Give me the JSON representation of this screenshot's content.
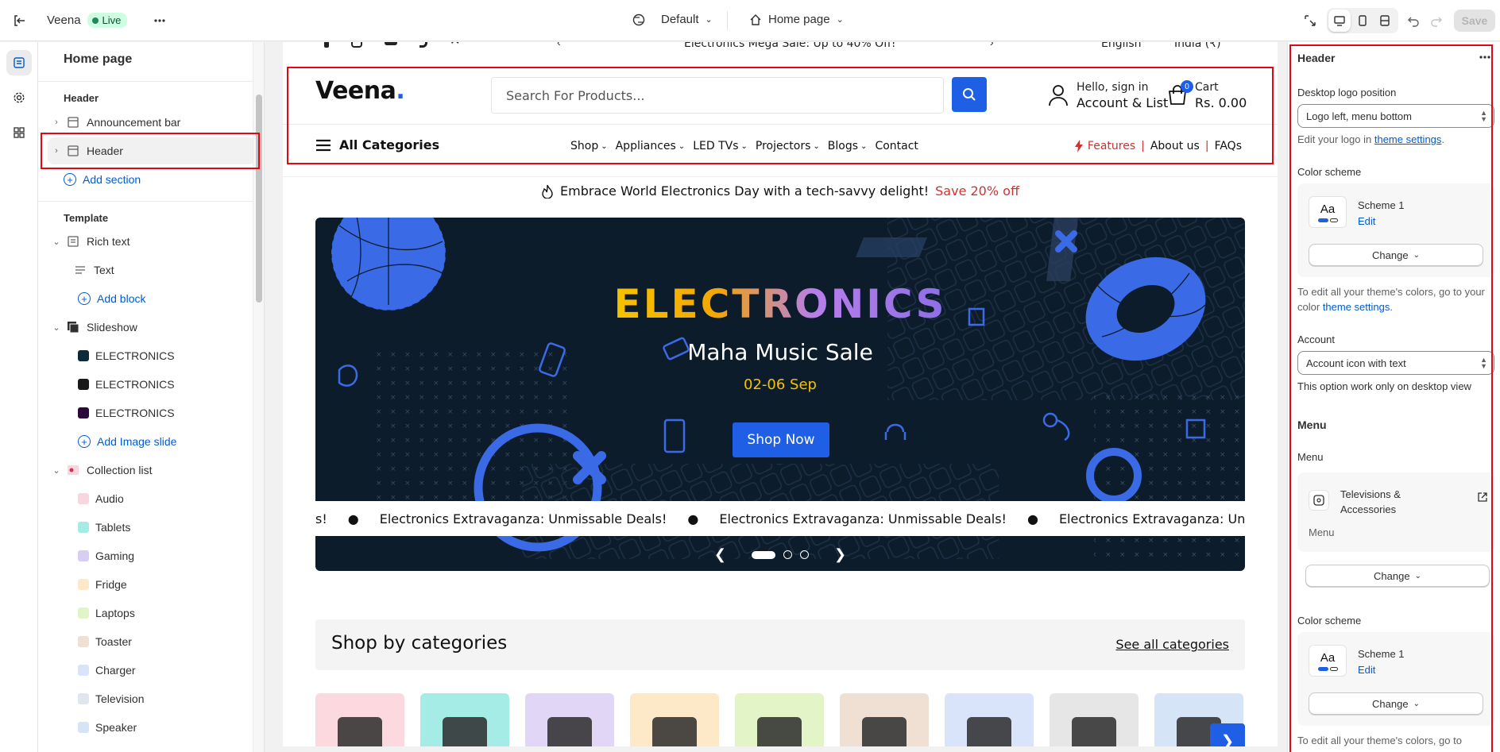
{
  "topbar": {
    "store_name": "Veena",
    "live_label": "Live",
    "theme_label": "Default",
    "page_label": "Home page",
    "save_label": "Save"
  },
  "left_panel": {
    "title": "Home page",
    "header_group": "Header",
    "sections": [
      {
        "label": "Announcement bar"
      },
      {
        "label": "Header"
      }
    ],
    "add_section_label": "Add section",
    "template_group": "Template",
    "template_items": [
      {
        "label": "Rich text"
      },
      {
        "label": "Text"
      },
      {
        "label": "Add block"
      },
      {
        "label": "Slideshow"
      },
      {
        "label": "ELECTRONICS",
        "color": "#0c2a3a"
      },
      {
        "label": "ELECTRONICS",
        "color": "#1a1a1a"
      },
      {
        "label": "ELECTRONICS",
        "color": "#2a0a3a"
      },
      {
        "label": "Add Image slide"
      },
      {
        "label": "Collection list"
      },
      {
        "label": "Audio"
      },
      {
        "label": "Tablets"
      },
      {
        "label": "Gaming"
      },
      {
        "label": "Fridge"
      },
      {
        "label": "Laptops"
      },
      {
        "label": "Toaster"
      },
      {
        "label": "Charger"
      },
      {
        "label": "Television"
      },
      {
        "label": "Speaker"
      }
    ]
  },
  "preview": {
    "announcement_partial": "Electronics Mega Sale: Up to 40% Off!",
    "language": "English",
    "country": "India (₹)",
    "logo_text": "Veena",
    "logo_dot": ".",
    "search_placeholder": "Search For Products...",
    "account_small": "Hello, sign in",
    "account_big": "Account & List",
    "cart_count": "0",
    "cart_small": "Cart",
    "cart_big": "Rs. 0.00",
    "all_categories": "All Categories",
    "menu_items": [
      "Shop",
      "Appliances",
      "LED TVs",
      "Projectors",
      "Blogs",
      "Contact"
    ],
    "menu_has_caret": [
      true,
      true,
      true,
      true,
      true,
      false
    ],
    "features_label": "Features",
    "about_label": "About us",
    "faqs_label": "FAQs",
    "promo_text": "Embrace World Electronics Day with a tech-savvy delight!",
    "promo_highlight": "Save 20% off",
    "banner_title": "ELECTRONICS",
    "banner_subtitle": "Maha Music Sale",
    "banner_date": "02-06 Sep",
    "banner_button": "Shop Now",
    "marquee_items": [
      "s!",
      "Electronics Extravaganza: Unmissable Deals!",
      "Electronics Extravaganza: Unmissable Deals!",
      "Electronics Extravaganza: Unmissable Deals!"
    ],
    "shop_categories_title": "Shop by categories",
    "see_all_label": "See all categories",
    "category_tile_colors": [
      "#fbd9df",
      "#a6ece6",
      "#e2d6f7",
      "#fde9c8",
      "#e3f5c7",
      "#efe0d3",
      "#d9e4fb",
      "#e6e6e6",
      "#d6e4f7"
    ]
  },
  "right_panel": {
    "title": "Header",
    "logo_position_label": "Desktop logo position",
    "logo_position_value": "Logo left, menu bottom",
    "logo_help_prefix": "Edit your logo in",
    "logo_help_link": "theme settings",
    "logo_help_suffix": ".",
    "color_scheme_label": "Color scheme",
    "scheme_name": "Scheme 1",
    "aa_label": "Aa",
    "edit_label": "Edit",
    "change_label": "Change",
    "colors_help_prefix": "To edit all your theme's colors, go to your color",
    "colors_help_link": "theme settings",
    "colors_help_suffix": ".",
    "account_label": "Account",
    "account_value": "Account icon with text",
    "account_help": "This option work only on desktop view",
    "menu_heading": "Menu",
    "menu_label": "Menu",
    "menu_name": "Televisions & Accessories",
    "menu_sub": "Menu",
    "color_scheme_label_2": "Color scheme",
    "colors_help_2": "To edit all your theme's colors, go to"
  }
}
